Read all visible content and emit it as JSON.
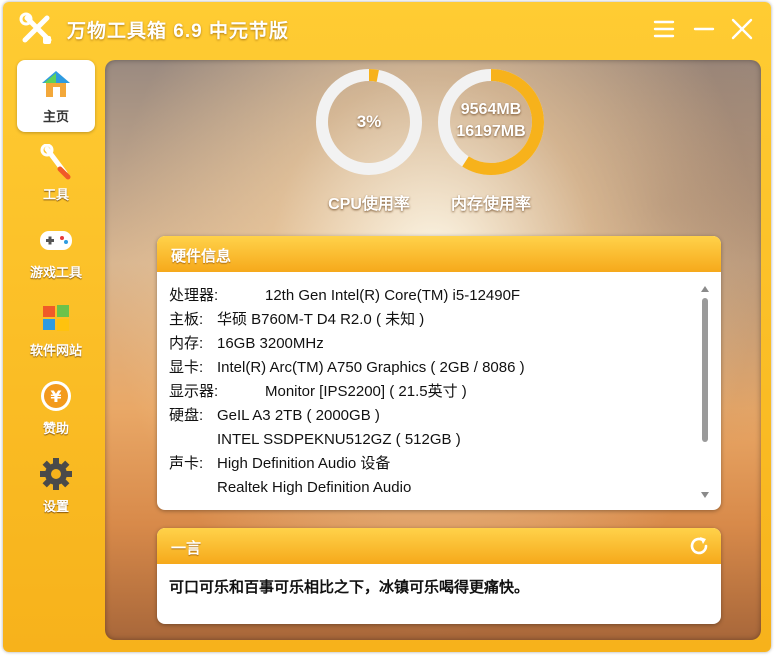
{
  "app": {
    "title": "万物工具箱 6.9 中元节版"
  },
  "sidebar": {
    "items": [
      {
        "label": "主页",
        "icon": "home-icon",
        "active": true
      },
      {
        "label": "工具",
        "icon": "wrench-icon",
        "active": false
      },
      {
        "label": "游戏工具",
        "icon": "gamepad-icon",
        "active": false
      },
      {
        "label": "软件网站",
        "icon": "windows-icon",
        "active": false
      },
      {
        "label": "赞助",
        "icon": "yen-coin-icon",
        "active": false
      },
      {
        "label": "设置",
        "icon": "gear-icon",
        "active": false
      }
    ]
  },
  "gauges": {
    "cpu": {
      "value_text": "3%",
      "percent": 3,
      "caption": "CPU使用率"
    },
    "memory": {
      "used_text": "9564MB",
      "total_text": "16197MB",
      "used_mb": 9564,
      "total_mb": 16197,
      "caption": "内存使用率"
    }
  },
  "hardware": {
    "title": "硬件信息",
    "rows": [
      {
        "label": "处理器:",
        "value": "12th Gen Intel(R) Core(TM) i5-12490F",
        "wide": true
      },
      {
        "label": "主板:",
        "value": "华硕 B760M-T D4 R2.0 ( 未知 )",
        "wide": false
      },
      {
        "label": "内存:",
        "value": "16GB 3200MHz",
        "wide": false
      },
      {
        "label": "显卡:",
        "value": "Intel(R) Arc(TM) A750 Graphics ( 2GB / 8086 )",
        "wide": false
      },
      {
        "label": "显示器:",
        "value": "Monitor [IPS2200] ( 21.5英寸 )",
        "wide": true
      },
      {
        "label": "硬盘:",
        "value": "GeIL A3 2TB ( 2000GB )",
        "wide": false
      },
      {
        "label": "",
        "value": "INTEL SSDPEKNU512GZ ( 512GB )",
        "wide": false
      },
      {
        "label": "声卡:",
        "value": "High Definition Audio 设备",
        "wide": false
      },
      {
        "label": "",
        "value": "Realtek High Definition Audio",
        "wide": false
      }
    ]
  },
  "quote": {
    "title": "一言",
    "text": "可口可乐和百事可乐相比之下，冰镇可乐喝得更痛快。"
  },
  "colors": {
    "accent": "#f7b21b",
    "accent_light": "#ffd24a",
    "gauge_track": "#f1f1f1"
  }
}
